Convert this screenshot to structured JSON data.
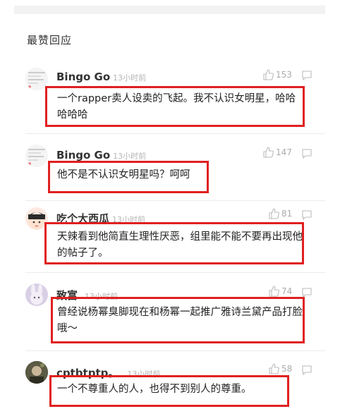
{
  "section_title": "最赞回应",
  "comments": [
    {
      "username": "Bingo Go",
      "time": "13小时前",
      "likes": "153",
      "content": "一个rapper卖人设卖的飞起。我不认识女明星，哈哈哈哈哈",
      "avatar_icon": "screenshot-avatar-icon"
    },
    {
      "username": "Bingo Go",
      "time": "13小时前",
      "likes": "147",
      "content": "他不是不认识女明星吗？呵呵",
      "avatar_icon": "screenshot-avatar-icon"
    },
    {
      "username": "吃个大西瓜",
      "time": "13小时前",
      "likes": "81",
      "content": "天辣看到他简直生理性厌恶，组里能不能不要再出现他的帖子了。",
      "avatar_icon": "cartoon-girl-avatar-icon"
    },
    {
      "username": "致富",
      "time": "13小时前",
      "likes": "74",
      "content": "曾经说杨幂臭脚现在和杨幂一起推广雅诗兰黛产品打脸哦～",
      "avatar_icon": "bunny-avatar-icon"
    },
    {
      "username": "cptbtptp。",
      "time": "13小时前",
      "likes": "58",
      "content": "一个不尊重人的人，也得不到别人的尊重。",
      "avatar_icon": "photo-avatar-icon"
    }
  ],
  "colors": {
    "highlight_box": "#e02020",
    "meta_gray": "#b5b5b5"
  }
}
